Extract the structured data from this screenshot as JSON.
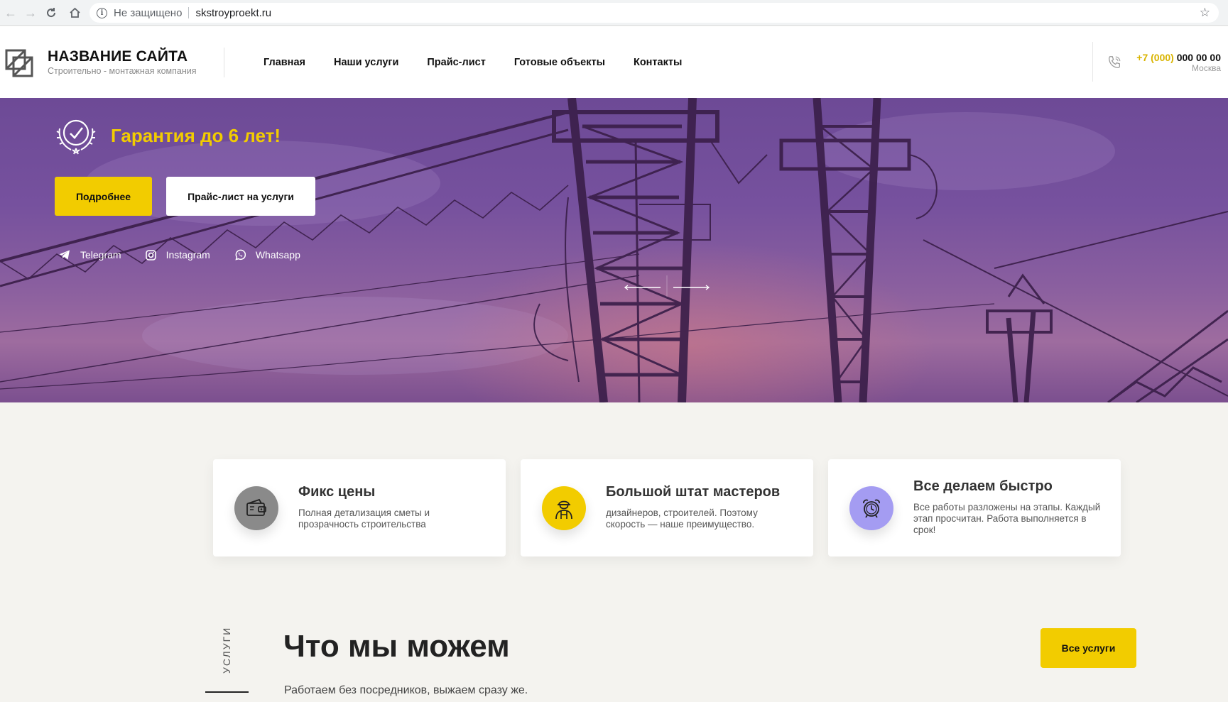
{
  "browser": {
    "security_label": "Не защищено",
    "url": "skstroyproekt.ru"
  },
  "header": {
    "site_name": "НАЗВАНИЕ САЙТА",
    "tagline": "Строительно - монтажная компания",
    "nav": [
      "Главная",
      "Наши услуги",
      "Прайс-лист",
      "Готовые объекты",
      "Контакты"
    ],
    "phone_code": "+7 (000)",
    "phone_number": " 000 00 00",
    "city": "Москва"
  },
  "hero": {
    "guarantee": "Гарантия до 6 лет!",
    "btn_more": "Подробнее",
    "btn_price": "Прайс-лист на услуги",
    "socials": [
      "Telegram",
      "Instagram",
      "Whatsapp"
    ]
  },
  "features": [
    {
      "title": "Фикс цены",
      "text": "Полная детализация сметы и прозрачность строительства",
      "icon": "wallet-icon",
      "color": "#8a8a8a"
    },
    {
      "title": "Большой штат мастеров",
      "text": "дизайнеров, строителей. Поэтому скорость — наше преимущество.",
      "icon": "worker-icon",
      "color": "#f2cc00"
    },
    {
      "title": "Все делаем быстро",
      "text": "Все работы разложены на этапы. Каждый этап просчитан. Работа выполняется в срок!",
      "icon": "alarm-clock-icon",
      "color": "#a49cf2"
    }
  ],
  "services": {
    "vertical_label": "УСЛУГИ",
    "heading": "Что мы можем",
    "subtitle": "Работаем без посредников, выжаем сразу же.",
    "btn_all": "Все услуги"
  },
  "colors": {
    "accent": "#f2cc00",
    "hero_purple": "#76519e"
  }
}
